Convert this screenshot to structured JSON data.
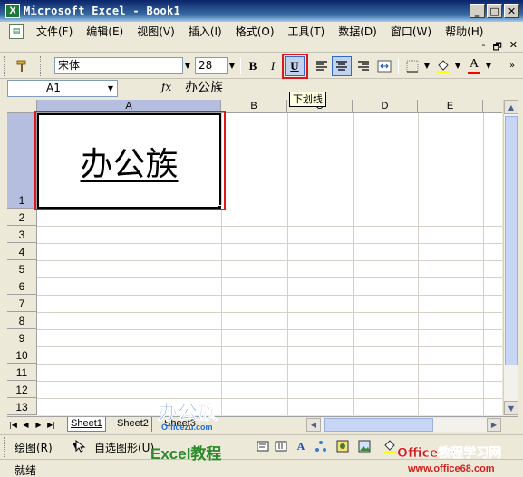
{
  "window": {
    "title": "Microsoft Excel - Book1",
    "app_icon": "excel-icon"
  },
  "window_buttons": {
    "minimize": "_",
    "restore": "□",
    "close": "✕"
  },
  "menu": {
    "items": [
      "文件(F)",
      "编辑(E)",
      "视图(V)",
      "插入(I)",
      "格式(O)",
      "工具(T)",
      "数据(D)",
      "窗口(W)",
      "帮助(H)"
    ],
    "mdi_buttons": [
      "-",
      "🗗",
      "✕"
    ]
  },
  "toolbar": {
    "font_name": "宋体",
    "font_size": "28",
    "bold_label": "B",
    "italic_label": "I",
    "underline_label": "U",
    "underline_tooltip": "下划线",
    "underline_active": true,
    "highlight_color": "#e0161e",
    "fill_color": "#ffff00",
    "font_color": "#ff0000",
    "font_color_label": "A"
  },
  "formula_bar": {
    "name_box": "A1",
    "fx_label": "fx",
    "content": "办公族"
  },
  "grid": {
    "columns": [
      "A",
      "B",
      "C",
      "D",
      "E"
    ],
    "rows": [
      "1",
      "2",
      "3",
      "4",
      "5",
      "6",
      "7",
      "8",
      "9",
      "10",
      "11",
      "12",
      "13"
    ],
    "active_cell": "A1",
    "cell_A1_value": "办公族",
    "cell_A1_underlined": true
  },
  "sheet_tabs": {
    "tabs": [
      "Sheet1",
      "Sheet2",
      "Sheet3"
    ],
    "active": "Sheet1"
  },
  "draw_toolbar": {
    "draw_label": "绘图(R)",
    "autoshape_label": "自选图形(U)"
  },
  "status_bar": {
    "text": "就绪"
  },
  "watermarks": {
    "logo_text": "办公族",
    "logo_url": "Officezu.com",
    "excel_tutorial": "Excel教程",
    "site_brand": "Office教程学习网",
    "site_url": "www.office68.com"
  }
}
